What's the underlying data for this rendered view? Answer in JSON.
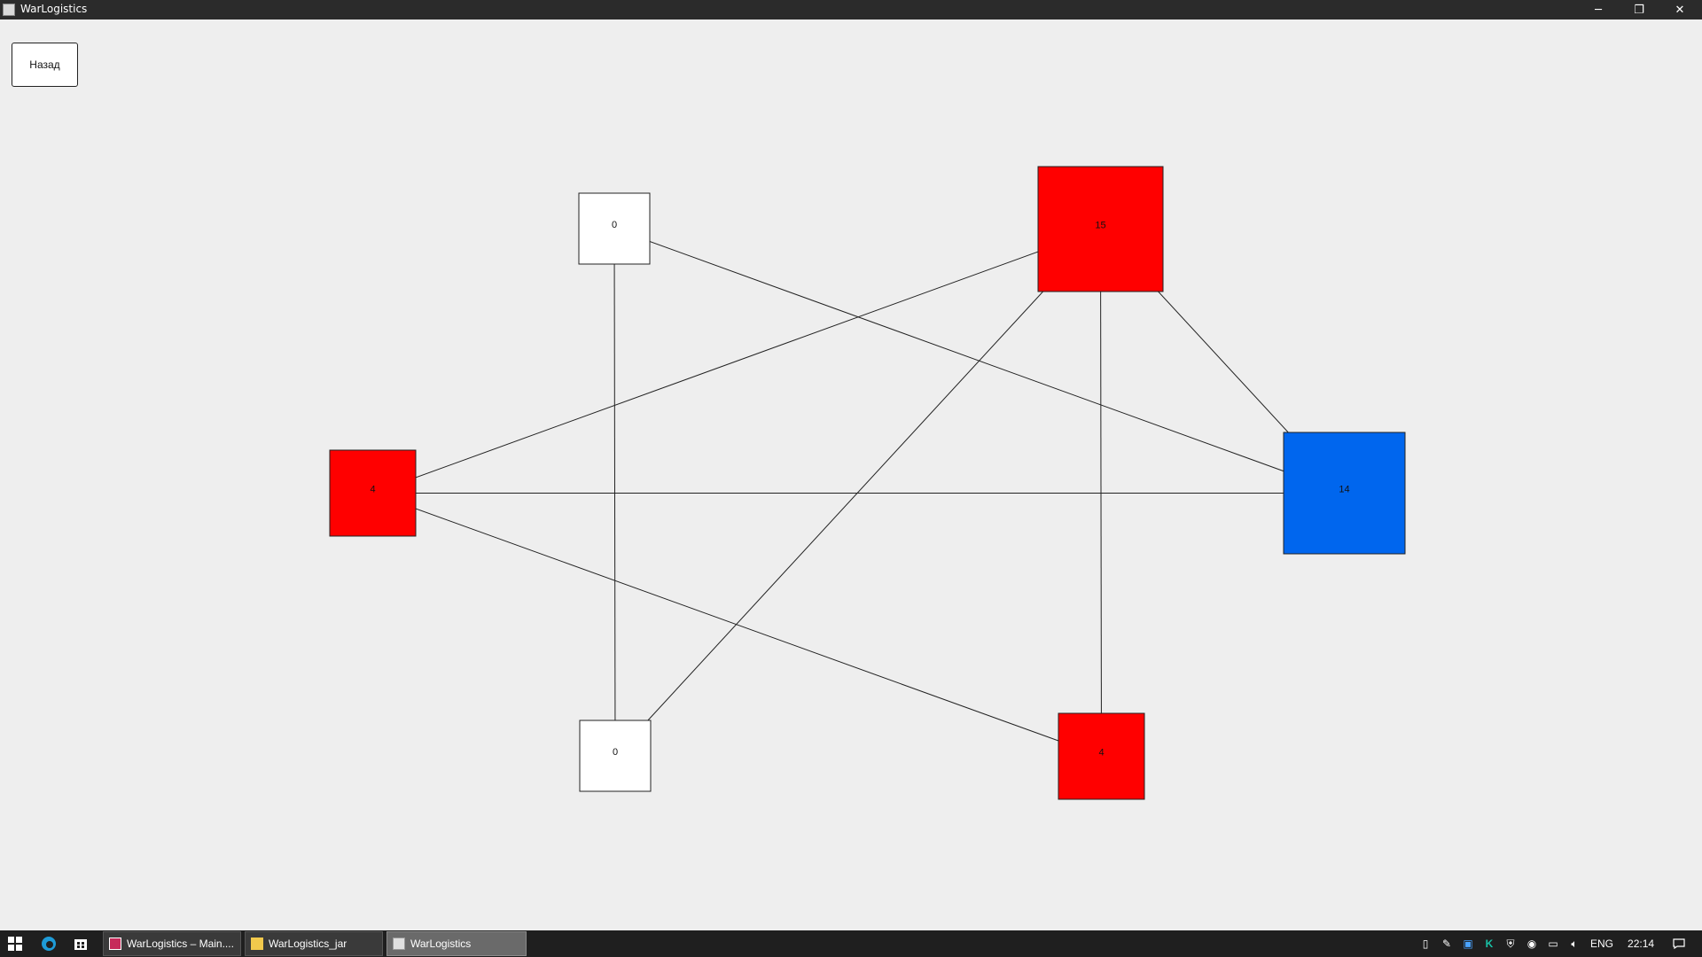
{
  "window": {
    "title": "WarLogistics"
  },
  "controls": {
    "minimize": "─",
    "restore": "❐",
    "close": "✕"
  },
  "back_button": {
    "label": "Назад"
  },
  "graph": {
    "nodes": [
      {
        "id": "top-left",
        "label": "0",
        "color": "#ffffff"
      },
      {
        "id": "top-right",
        "label": "15",
        "color": "#ff0000"
      },
      {
        "id": "left",
        "label": "4",
        "color": "#ff0000"
      },
      {
        "id": "right",
        "label": "14",
        "color": "#0066ee"
      },
      {
        "id": "bottom-left",
        "label": "0",
        "color": "#ffffff"
      },
      {
        "id": "bottom-right",
        "label": "4",
        "color": "#ff0000"
      }
    ],
    "edges": [
      [
        "top-left",
        "bottom-left"
      ],
      [
        "top-left",
        "right"
      ],
      [
        "top-right",
        "left"
      ],
      [
        "top-right",
        "bottom-left"
      ],
      [
        "top-right",
        "bottom-right"
      ],
      [
        "top-right",
        "right"
      ],
      [
        "left",
        "right"
      ],
      [
        "left",
        "bottom-right"
      ]
    ]
  },
  "taskbar": {
    "tasks": [
      {
        "label": "WarLogistics – Main....",
        "icon": "intellij-icon",
        "active": false
      },
      {
        "label": "WarLogistics_jar",
        "icon": "folder-icon",
        "active": false
      },
      {
        "label": "WarLogistics",
        "icon": "java-app-icon",
        "active": true
      }
    ],
    "tray": {
      "language": "ENG",
      "time": "22:14"
    }
  }
}
